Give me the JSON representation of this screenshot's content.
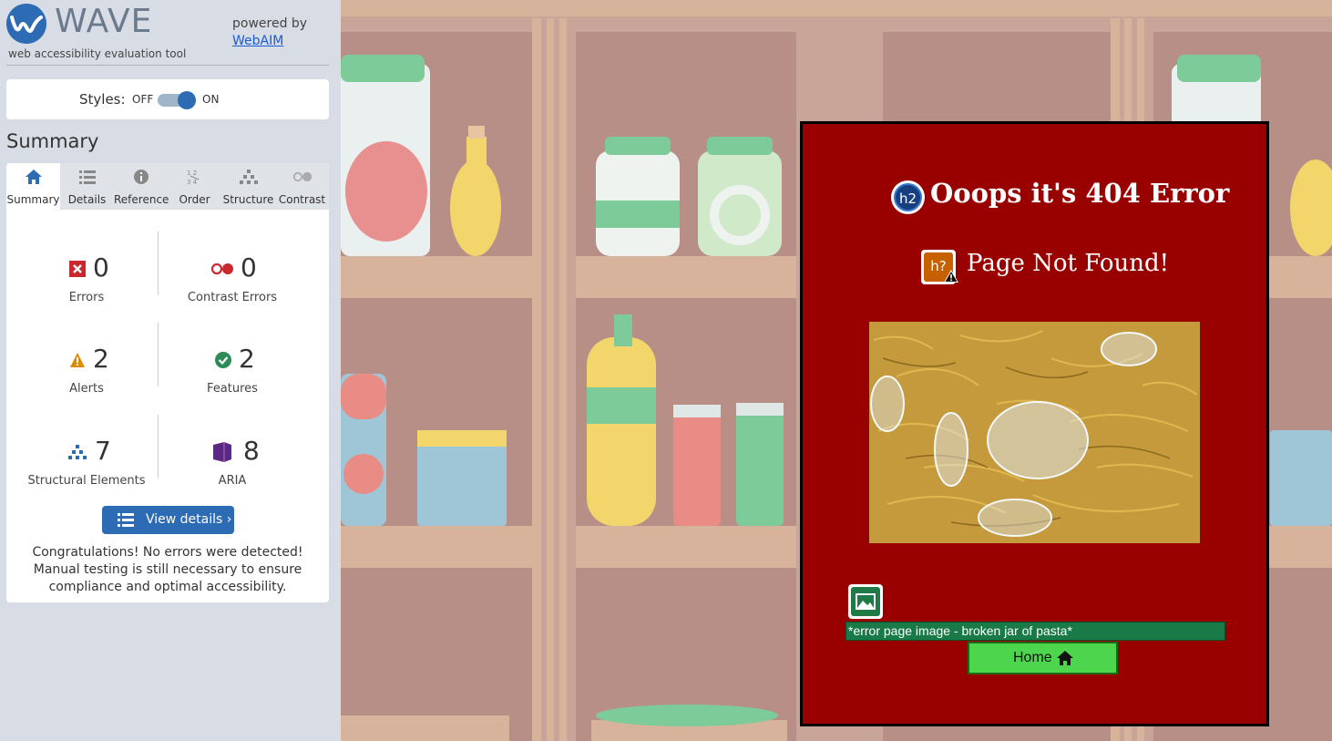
{
  "wave": {
    "title": "WAVE",
    "subtitle": "web accessibility evaluation tool",
    "powered_by": "powered by",
    "webaim_link": "WebAIM"
  },
  "styles_toggle": {
    "label": "Styles:",
    "off": "OFF",
    "on": "ON",
    "state": "on"
  },
  "summary_heading": "Summary",
  "tabs": [
    {
      "label": "Summary",
      "icon": "home-icon",
      "active": true
    },
    {
      "label": "Details",
      "icon": "list-icon",
      "active": false
    },
    {
      "label": "Reference",
      "icon": "info-icon",
      "active": false
    },
    {
      "label": "Order",
      "icon": "order-icon",
      "active": false
    },
    {
      "label": "Structure",
      "icon": "structure-icon",
      "active": false
    },
    {
      "label": "Contrast",
      "icon": "contrast-icon",
      "active": false
    }
  ],
  "stats": {
    "errors": {
      "count": "0",
      "label": "Errors",
      "icon": "error-icon",
      "color": "#c8282e"
    },
    "contrast_errors": {
      "count": "0",
      "label": "Contrast Errors",
      "icon": "contrast-error-icon",
      "color": "#c8282e"
    },
    "alerts": {
      "count": "2",
      "label": "Alerts",
      "icon": "alert-icon",
      "color": "#e08a00"
    },
    "features": {
      "count": "2",
      "label": "Features",
      "icon": "feature-check-icon",
      "color": "#2e8b57"
    },
    "structural": {
      "count": "7",
      "label": "Structural Elements",
      "icon": "structure-icon",
      "color": "#2d6bb5"
    },
    "aria": {
      "count": "8",
      "label": "ARIA",
      "icon": "aria-icon",
      "color": "#5a2a82"
    }
  },
  "view_details_label": "View details ›",
  "congrats": "Congratulations! No errors were detected! Manual testing is still necessary to ensure compliance and optimal accessibility.",
  "card": {
    "h2_badge": "h2",
    "title": "Ooops it's 404 Error",
    "heading_badge": "h?",
    "subtitle": "Page Not Found!",
    "image_badge_icon": "image-icon",
    "alt_text": "*error page image - broken jar of pasta*",
    "home_label": "Home",
    "home_icon": "home-icon",
    "background": "#990000",
    "button_color": "#4dd64d"
  }
}
